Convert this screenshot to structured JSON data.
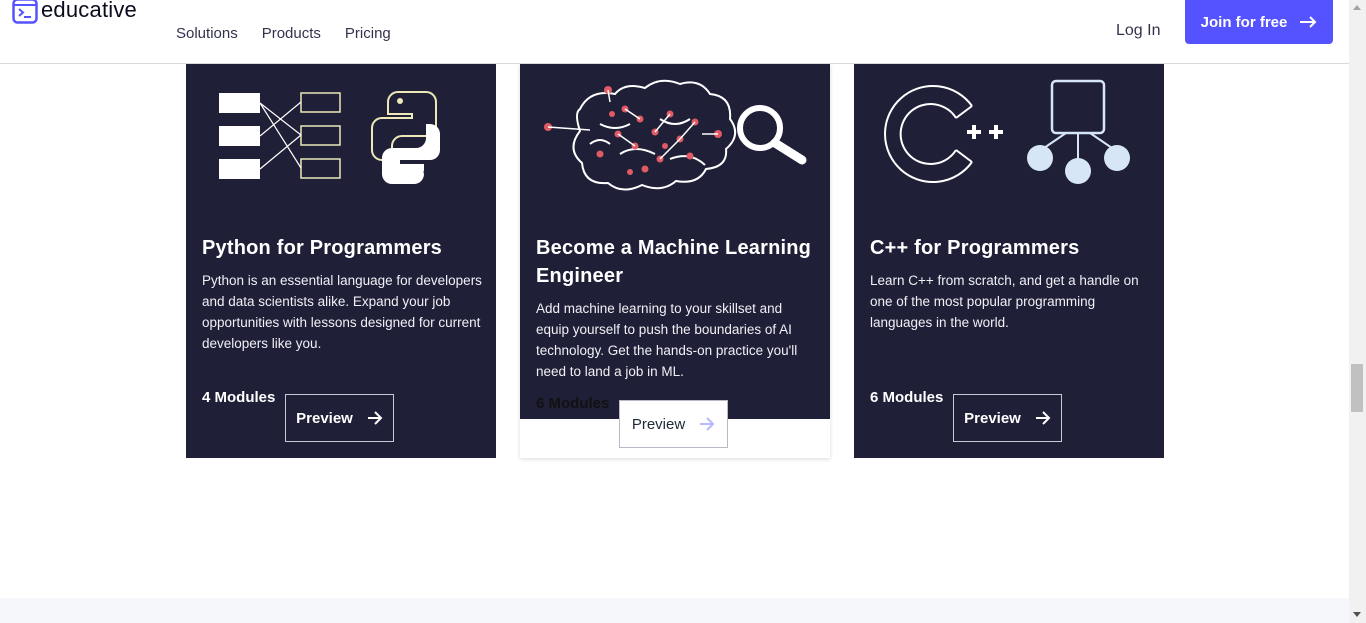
{
  "brand": {
    "name": "educative",
    "accent": "#5553ff",
    "dark": "#1f1f38"
  },
  "nav": {
    "items": [
      "Solutions",
      "Products",
      "Pricing"
    ],
    "login": "Log In",
    "join": "Join for free"
  },
  "cards": [
    {
      "title": "Python for Programmers",
      "description": "Python is an essential language for developers and data scientists alike. Expand your job opportunities with lessons designed for current developers like you.",
      "modules": "4 Modules",
      "preview": "Preview",
      "icon": "python-icon"
    },
    {
      "title": "Become a Machine Learning Engineer",
      "description": "Add machine learning to your skillset and equip yourself to push the boundaries of AI technology. Get the hands-on practice you'll need to land a job in ML.",
      "modules": "6 Modules",
      "preview": "Preview",
      "icon": "brain-icon"
    },
    {
      "title": "C++ for Programmers",
      "description": "Learn C++ from scratch, and get a handle on one of the most popular programming languages in the world.",
      "modules": "6 Modules",
      "preview": "Preview",
      "icon": "cplusplus-icon"
    }
  ]
}
